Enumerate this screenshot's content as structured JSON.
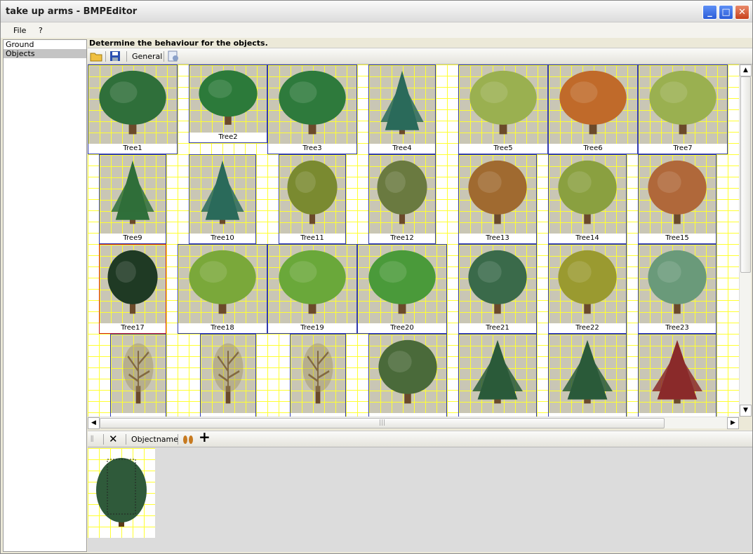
{
  "window": {
    "title": "take up arms - BMPEditor"
  },
  "menu": {
    "file": "File",
    "help": "?"
  },
  "layers": [
    {
      "label": "Ground",
      "selected": false
    },
    {
      "label": "Objects",
      "selected": true
    }
  ],
  "heading": "Determine the behaviour for the objects.",
  "toolbar_top": {
    "general_label": "General"
  },
  "toolbar_bottom": {
    "objectname_label": "Objectname"
  },
  "tiles": [
    {
      "label": "Tree1",
      "color": "#2f6f3a",
      "shape": "round"
    },
    {
      "label": "Tree2",
      "color": "#2c7a3a",
      "shape": "round"
    },
    {
      "label": "Tree3",
      "color": "#2e7a3c",
      "shape": "round"
    },
    {
      "label": "Tree4",
      "color": "#2a6a5a",
      "shape": "conifer"
    },
    {
      "label": "Tree5",
      "color": "#9ab050",
      "shape": "round"
    },
    {
      "label": "Tree6",
      "color": "#c06a2a",
      "shape": "round"
    },
    {
      "label": "Tree7",
      "color": "#9ab050",
      "shape": "round"
    },
    {
      "label": "Tree9",
      "color": "#2f6f3a",
      "shape": "conifer"
    },
    {
      "label": "Tree10",
      "color": "#2a6a5a",
      "shape": "conifer"
    },
    {
      "label": "Tree11",
      "color": "#7a8a30",
      "shape": "round"
    },
    {
      "label": "Tree12",
      "color": "#6a7a40",
      "shape": "round"
    },
    {
      "label": "Tree13",
      "color": "#a06a30",
      "shape": "round"
    },
    {
      "label": "Tree14",
      "color": "#8aa040",
      "shape": "round"
    },
    {
      "label": "Tree15",
      "color": "#b0683a",
      "shape": "round"
    },
    {
      "label": "Tree17",
      "color": "#1f3a24",
      "shape": "round",
      "selected": true
    },
    {
      "label": "Tree18",
      "color": "#7aa83a",
      "shape": "round"
    },
    {
      "label": "Tree19",
      "color": "#6aa83a",
      "shape": "round"
    },
    {
      "label": "Tree20",
      "color": "#4a9a3a",
      "shape": "round"
    },
    {
      "label": "Tree21",
      "color": "#3a6a4a",
      "shape": "round"
    },
    {
      "label": "Tree22",
      "color": "#9a9a30",
      "shape": "round"
    },
    {
      "label": "Tree23",
      "color": "#6a9a7a",
      "shape": "round"
    },
    {
      "label": "",
      "color": "#a09060",
      "shape": "bare"
    },
    {
      "label": "",
      "color": "#a09060",
      "shape": "bare"
    },
    {
      "label": "",
      "color": "#a09060",
      "shape": "bare"
    },
    {
      "label": "",
      "color": "#4a6a3a",
      "shape": "round"
    },
    {
      "label": "",
      "color": "#2a5a3a",
      "shape": "conifer"
    },
    {
      "label": "",
      "color": "#2a5a3a",
      "shape": "conifer"
    },
    {
      "label": "",
      "color": "#8a2a2a",
      "shape": "conifer"
    }
  ],
  "preview": {
    "color": "#2f5a3a"
  }
}
